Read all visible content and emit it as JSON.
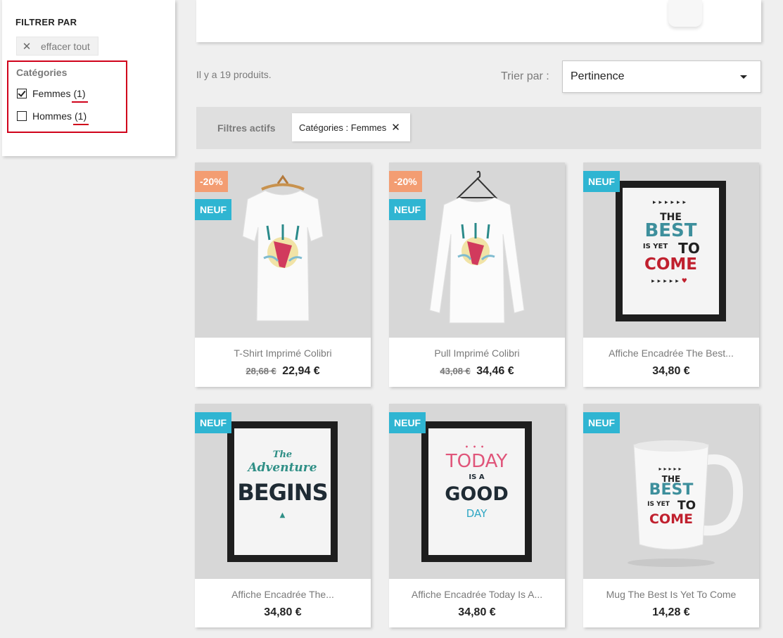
{
  "sidebar": {
    "title": "FILTRER PAR",
    "clear_all": "effacer tout",
    "categories_title": "Catégories",
    "categories": [
      {
        "label": "Femmes",
        "count": "(1)",
        "checked": true
      },
      {
        "label": "Hommes",
        "count": "(1)",
        "checked": false
      }
    ]
  },
  "listing": {
    "product_count": "Il y a 19 produits.",
    "sort_label": "Trier par :",
    "sort_value": "Pertinence",
    "active_filters_label": "Filtres actifs",
    "active_filter_chip": "Catégories : Femmes"
  },
  "products": [
    {
      "name": "T-Shirt Imprimé Colibri",
      "old_price": "28,68 €",
      "price": "22,94 €",
      "discount": "-20%",
      "flag": "NEUF"
    },
    {
      "name": "Pull Imprimé Colibri",
      "old_price": "43,08 €",
      "price": "34,46 €",
      "discount": "-20%",
      "flag": "NEUF"
    },
    {
      "name": "Affiche Encadrée The Best...",
      "price": "34,80 €",
      "flag": "NEUF"
    },
    {
      "name": "Affiche Encadrée The...",
      "price": "34,80 €",
      "flag": "NEUF"
    },
    {
      "name": "Affiche Encadrée Today Is A...",
      "price": "34,80 €",
      "flag": "NEUF"
    },
    {
      "name": "Mug The Best Is Yet To Come",
      "price": "14,28 €",
      "flag": "NEUF"
    }
  ],
  "artwork": {
    "best_poster": [
      "THE",
      "BEST",
      "IS YET",
      "TO",
      "COME"
    ],
    "adventure_poster": [
      "The",
      "Adventure",
      "BEGINS"
    ],
    "today_poster": [
      "TODAY",
      "IS A",
      "GOOD",
      "DAY"
    ],
    "mug": [
      "THE",
      "BEST",
      "IS YET",
      "TO",
      "COME"
    ]
  },
  "colors": {
    "accent": "#2fb5d2",
    "discount": "#f39d72",
    "highlight_border": "#d0021b"
  }
}
